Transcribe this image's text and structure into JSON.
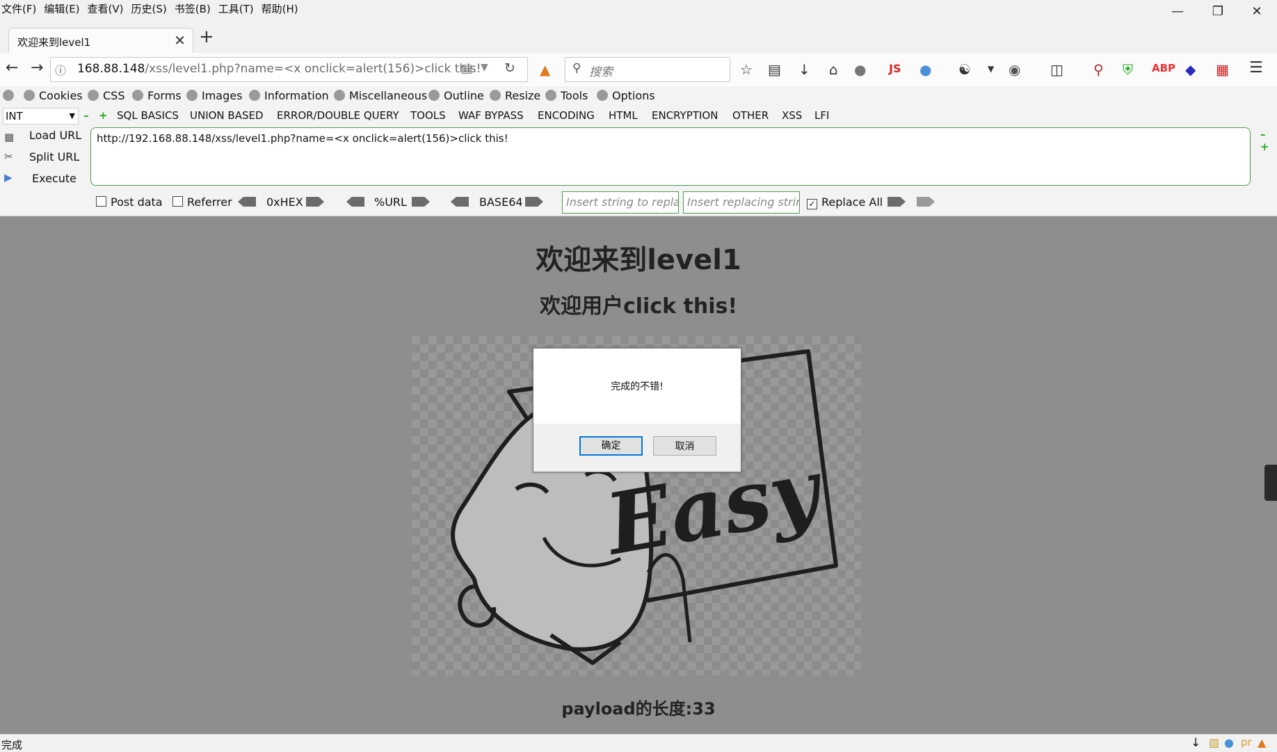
{
  "menubar": {
    "items": [
      "文件(F)",
      "编辑(E)",
      "查看(V)",
      "历史(S)",
      "书签(B)",
      "工具(T)",
      "帮助(H)"
    ]
  },
  "window_controls": {
    "minimize": "—",
    "restore": "❐",
    "close": "✕"
  },
  "tab": {
    "title": "欢迎来到level1",
    "close": "✕",
    "new_tab": "+"
  },
  "navbar": {
    "url_host": "168.88.148",
    "url_path": "/xss/level1.php?name=<x onclick=alert(156)>click this!",
    "search_placeholder": "搜索"
  },
  "bookmarks": [
    "Cookies",
    "CSS",
    "Forms",
    "Images",
    "Information",
    "Miscellaneous",
    "Outline",
    "Resize",
    "Tools",
    "Options"
  ],
  "hackbar": {
    "select_value": "INT",
    "menus": [
      "SQL BASICS",
      "UNION BASED",
      "ERROR/DOUBLE QUERY",
      "TOOLS",
      "WAF BYPASS",
      "ENCODING",
      "HTML",
      "ENCRYPTION",
      "OTHER",
      "XSS",
      "LFI"
    ],
    "load_url": "Load URL",
    "split_url": "Split URL",
    "execute": "Execute",
    "url_value": "http://192.168.88.148/xss/level1.php?name=<x onclick=alert(156)>click this!",
    "post_data": "Post data",
    "referrer": "Referrer",
    "hex": "0xHEX",
    "urlenc": "%URL",
    "base64": "BASE64",
    "replace_placeholder": "Insert string to replace",
    "replacing_placeholder": "Insert replacing string",
    "replace_all": "Replace All"
  },
  "page": {
    "heading": "欢迎来到level1",
    "subheading": "欢迎用户click this!",
    "payload_length": "payload的长度:33",
    "image_text": "Easy"
  },
  "dialog": {
    "message": "完成的不错!",
    "ok": "确定",
    "cancel": "取消"
  },
  "statusbar": {
    "text": "完成"
  }
}
